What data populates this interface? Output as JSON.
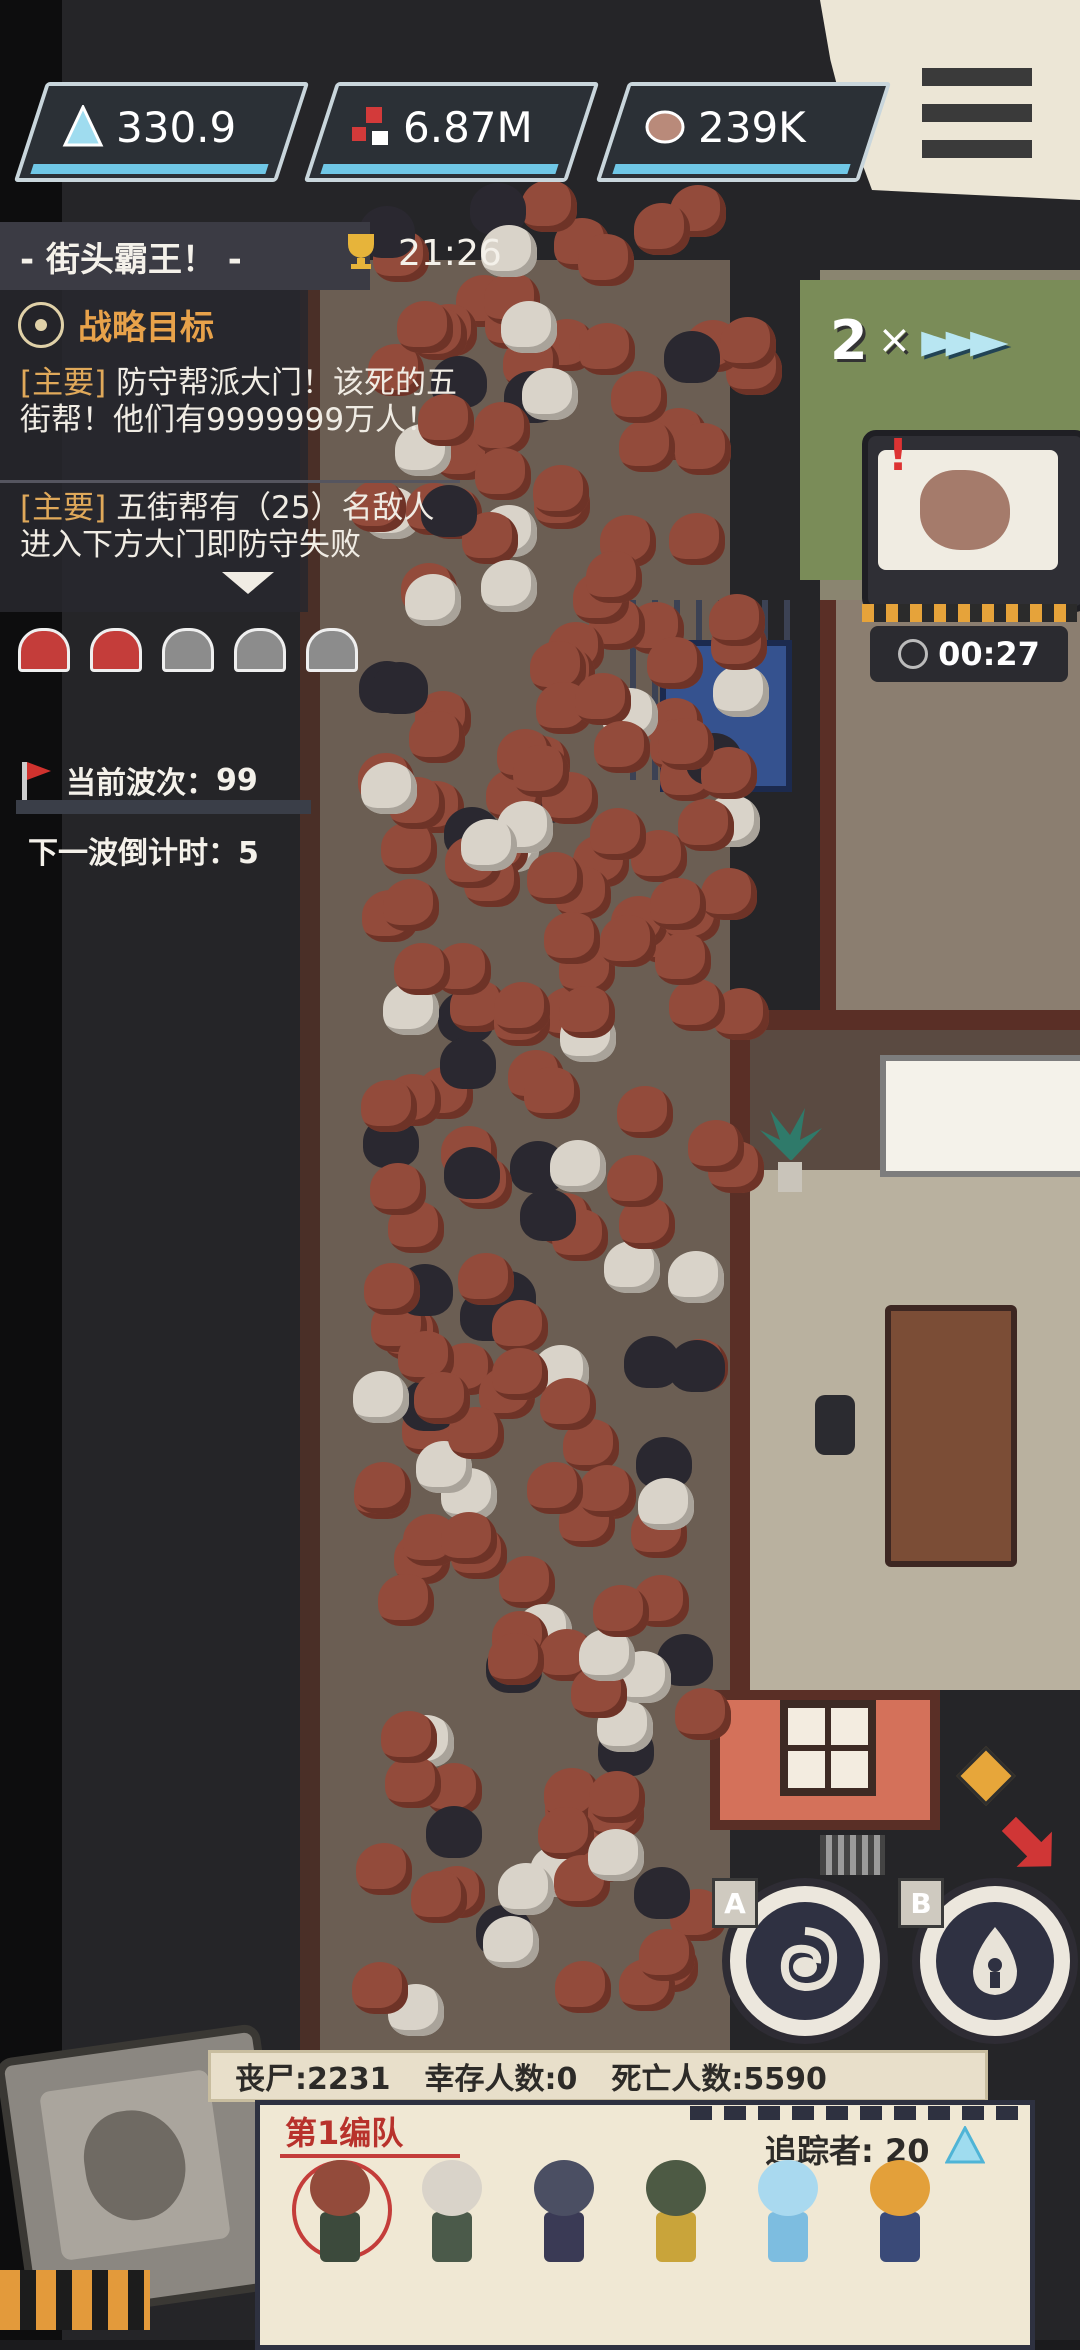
{
  "resources": [
    {
      "icon": "tracker-crystal-icon",
      "value": "330.9"
    },
    {
      "icon": "blood-cells-icon",
      "value": "6.87M"
    },
    {
      "icon": "meat-icon",
      "value": "239K"
    }
  ],
  "stage": {
    "title": "- 街头霸王！ -",
    "timer": "21:26"
  },
  "objectives": {
    "header": "战略目标",
    "items": [
      {
        "tag": "[主要]",
        "text": "防守帮派大门！该死的五街帮！他们有9999999万人！"
      },
      {
        "tag": "[主要]",
        "text": "五街帮有（25）名敌人进入下方大门即防守失败"
      }
    ]
  },
  "lives": {
    "remaining": 2,
    "total": 5
  },
  "waves": {
    "current_label": "当前波次：",
    "current": "99",
    "next_label": "下一波倒计时：",
    "next": "5"
  },
  "speed": {
    "multiplier": "2",
    "symbol": "×"
  },
  "reward": {
    "alert": "!",
    "timer": "00:27"
  },
  "skills": [
    {
      "key": "A",
      "icon": "swirl-icon"
    },
    {
      "key": "B",
      "icon": "flame-figure-icon"
    }
  ],
  "stats": {
    "zombies": "丧尸:2231",
    "survivors": "幸存人数:0",
    "dead": "死亡人数:5590"
  },
  "team": {
    "title": "第1编队",
    "tracker_label": "追踪者: 20",
    "units": [
      {
        "name": "red-head-zombie",
        "head": "#934b3b",
        "body": "#3c4a3c",
        "selected": true
      },
      {
        "name": "white-head-zombie",
        "head": "#d9d3c9",
        "body": "#4b5a4a"
      },
      {
        "name": "dark-beast",
        "head": "#4b4f63",
        "body": "#3a3a55"
      },
      {
        "name": "green-zombie",
        "head": "#4d5a44",
        "body": "#c9a43a"
      },
      {
        "name": "blue-ghost",
        "head": "#a9d9ef",
        "body": "#7dbde0"
      },
      {
        "name": "hardhat-worker",
        "head": "#e3a03a",
        "body": "#3a4a78"
      }
    ]
  },
  "colors": {
    "accent": "#e8a24a",
    "alert": "#c43d3a",
    "resource_bar": "#6fc7e6"
  }
}
